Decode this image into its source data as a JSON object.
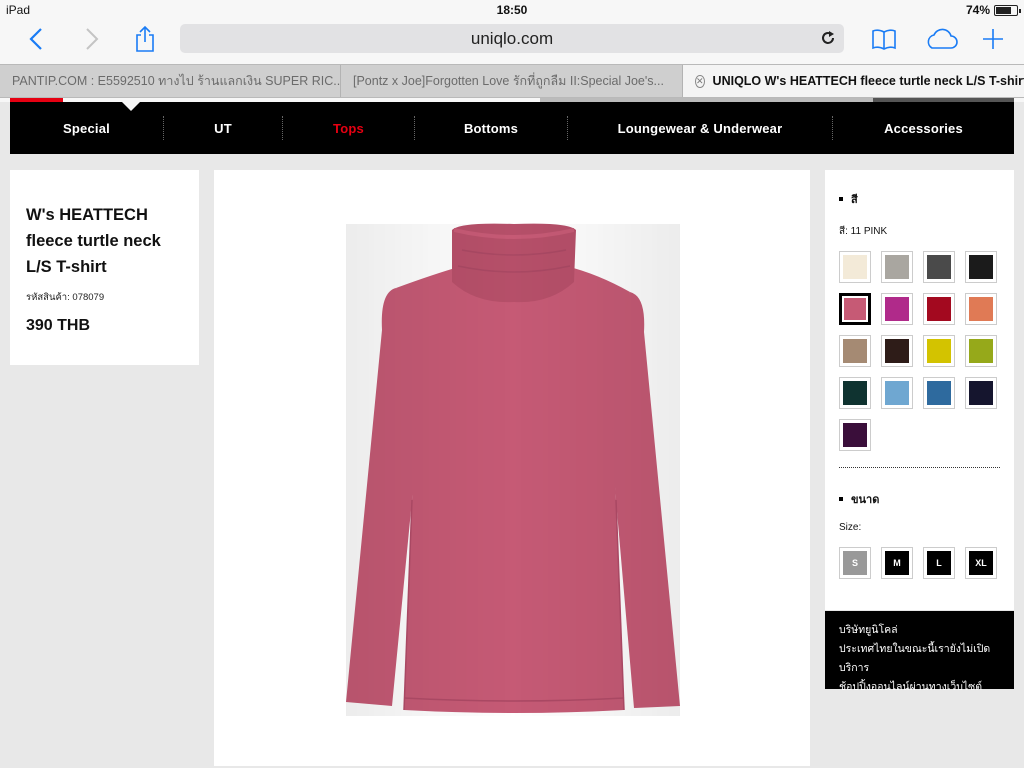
{
  "status_bar": {
    "device": "iPad",
    "time": "18:50",
    "battery": "74%",
    "battery_level": 0.74
  },
  "browser": {
    "url": "uniqlo.com",
    "tabs": [
      {
        "label": "PANTIP.COM : E5592510 ทางไป ร้านแลกเงิน SUPER RIC..."
      },
      {
        "label": "[Pontz x Joe]Forgotten Love รักที่ถูกลืม II:Special Joe's..."
      },
      {
        "label": "UNIQLO W's HEATTECH fleece turtle neck L/S T-shirt"
      }
    ]
  },
  "nav": {
    "items": [
      {
        "label": "Special"
      },
      {
        "label": "UT"
      },
      {
        "label": "Tops"
      },
      {
        "label": "Bottoms"
      },
      {
        "label": "Loungewear & Underwear"
      },
      {
        "label": "Accessories"
      }
    ],
    "active_color": "#e60012"
  },
  "product": {
    "title": "W's HEATTECH fleece turtle neck L/S T-shirt",
    "code": "รหัสสินค้า: 078079",
    "price": "390 THB",
    "image_color": "#c65a75"
  },
  "options": {
    "color_heading": "สี",
    "color_selected": "สี: 11 PINK",
    "swatches": [
      "#f3ead8",
      "#a9a6a0",
      "#4a4a4a",
      "#1b1b1b",
      "#c65a75",
      "#b02a8a",
      "#a3091f",
      "#e07a55",
      "#a58a73",
      "#2e1c18",
      "#d3c300",
      "#96a91a",
      "#0f3330",
      "#6fa7d1",
      "#2e6a9e",
      "#15152e",
      "#3a0e3a"
    ],
    "selected_swatch": 4,
    "size_heading": "ขนาด",
    "size_label": "Size:",
    "sizes": [
      "S",
      "M",
      "L",
      "XL"
    ]
  },
  "notice": {
    "line1": "บริษัทยูนิโคล่",
    "line2": "ประเทศไทยในขณะนี้เรายังไม่เปิดบริการ",
    "line3": "ช้อปปิ้งออนไลน์ผ่านทางเว็บไซต์"
  }
}
